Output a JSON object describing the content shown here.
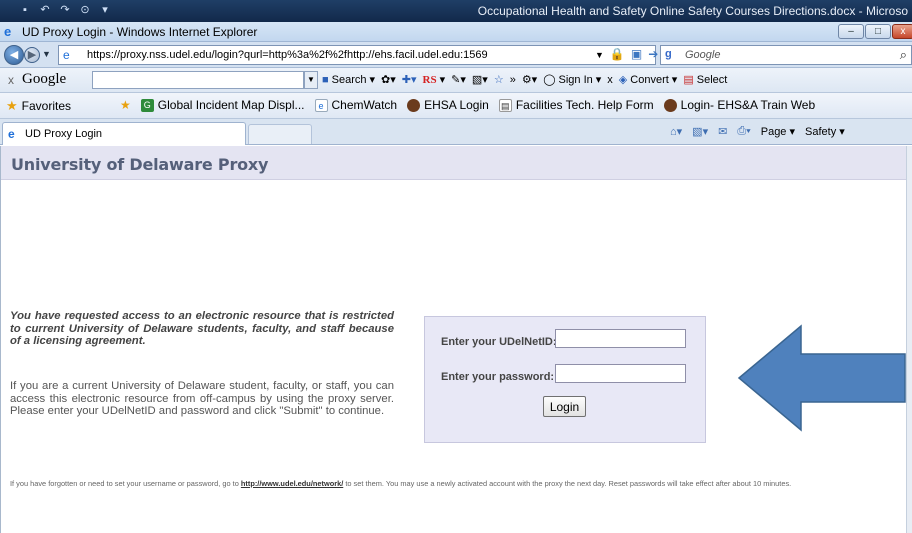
{
  "word": {
    "title": "Occupational Health and Safety Online Safety Courses Directions.docx - Microso"
  },
  "ie": {
    "window_title": "UD Proxy Login - Windows Internet Explorer",
    "address_url": "https://proxy.nss.udel.edu/login?qurl=http%3a%2f%2fhttp://ehs.facil.udel.edu:1569",
    "search_placeholder": "Google",
    "google_toolbar": {
      "logo": "Google",
      "search": "Search",
      "rs": "RS",
      "sign_in": "Sign In",
      "convert": "Convert",
      "select": "Select"
    },
    "favorites": {
      "label": "Favorites",
      "items": [
        {
          "label": "Global Incident Map Displ...",
          "icon": "map-icon"
        },
        {
          "label": "ChemWatch",
          "icon": "ie-page-icon"
        },
        {
          "label": "EHSA Login",
          "icon": "site-icon"
        },
        {
          "label": "Facilities Tech. Help Form",
          "icon": "form-icon"
        },
        {
          "label": "Login- EHS&A Train Web",
          "icon": "site-icon"
        }
      ]
    },
    "tab": {
      "label": "UD Proxy Login"
    },
    "command_bar": {
      "page": "Page",
      "safety": "Safety"
    }
  },
  "page": {
    "header_title": "University of Delaware Proxy",
    "intro_bold": "You have requested access to an electronic resource that is restricted to current University of Delaware students, faculty, and staff because of a licensing agreement.",
    "intro_plain": "If you are a current University of Delaware student, faculty, or staff, you can access this electronic resource from off-campus by using the proxy server. Please enter your UDelNetID and password and click \"Submit\" to continue.",
    "login": {
      "userid_label": "Enter your UDelNetID:",
      "password_label": "Enter your password:",
      "userid_value": "",
      "password_value": "",
      "button": "Login"
    },
    "footer": {
      "before_link": "If you have forgotten or need to set your username or password, go to ",
      "link": "http://www.udel.edu/network/",
      "after_link": " to set them. You may use a newly activated account with the proxy the next day. Reset passwords will take effect after about 10 minutes."
    }
  },
  "colors": {
    "header_bg": "#e4e4f2",
    "header_text": "#55607a",
    "login_box_bg": "#e8e8f6",
    "arrow_fill": "#4f81bd"
  }
}
